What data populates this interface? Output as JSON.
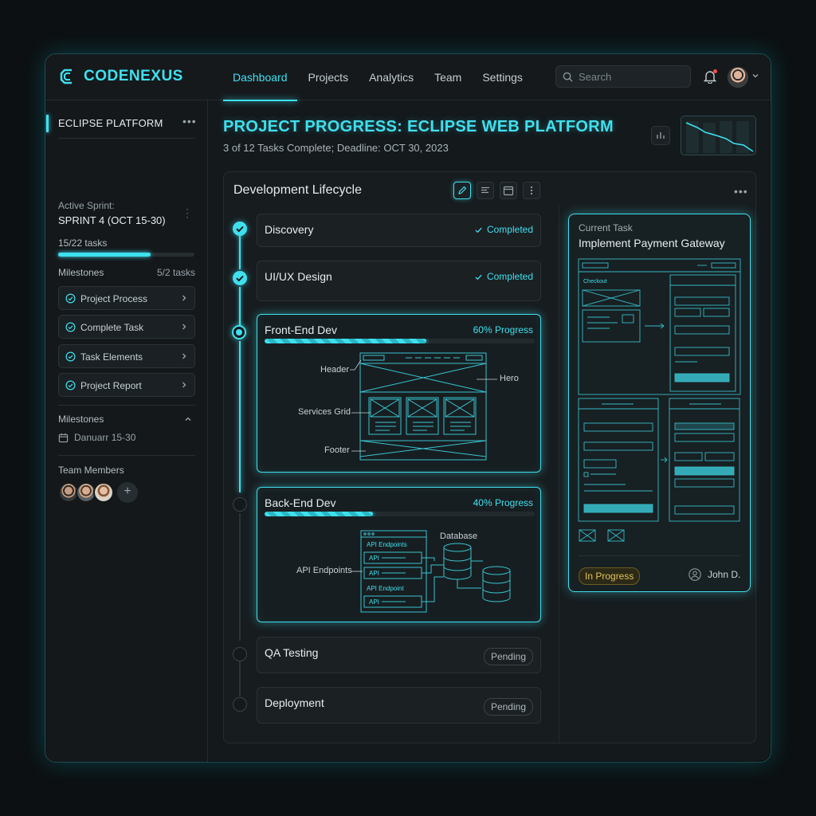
{
  "app": {
    "logo_text": "CODENEXUS"
  },
  "nav": {
    "items": [
      {
        "label": "Dashboard",
        "active": true
      },
      {
        "label": "Projects",
        "active": false
      },
      {
        "label": "Analytics",
        "active": false
      },
      {
        "label": "Team",
        "active": false
      },
      {
        "label": "Settings",
        "active": false
      }
    ]
  },
  "search": {
    "placeholder": "Search"
  },
  "sidebar": {
    "project_name": "ECLIPSE PLATFORM",
    "sprint_label": "Active Sprint:",
    "sprint_value": "SPRINT 4 (OCT 15-30)",
    "tasks_text": "15/22 tasks",
    "tasks_progress": 0.68,
    "milestones_label": "Milestones",
    "milestones_count": "5/2 tasks",
    "milestones": [
      {
        "label": "Project Process"
      },
      {
        "label": "Complete Task"
      },
      {
        "label": "Task Elements"
      },
      {
        "label": "Project Report"
      }
    ],
    "milestones2_label": "Milestones",
    "date_text": "Danuarr 15-30",
    "team_label": "Team Members"
  },
  "main": {
    "title": "PROJECT PROGRESS: ECLIPSE WEB PLATFORM",
    "subtitle": "3 of 12 Tasks Complete; Deadline: OCT 30, 2023"
  },
  "lifecycle": {
    "title": "Development Lifecycle",
    "stages": [
      {
        "title": "Discovery",
        "status": "Completed"
      },
      {
        "title": "UI/UX Design",
        "status": "Completed"
      },
      {
        "title": "Front-End Dev",
        "status": "60% Progress",
        "progress": 0.6,
        "wireframe_labels": {
          "header": "Header",
          "hero": "Hero",
          "grid": "Services Grid",
          "footer": "Footer"
        }
      },
      {
        "title": "Back-End Dev",
        "status": "40% Progress",
        "progress": 0.4,
        "diagram_labels": {
          "api": "API Endpoints",
          "api_box1": "API Endpoints",
          "api_box2": "API Endpoint",
          "api_item": "API",
          "database": "Database"
        }
      },
      {
        "title": "QA Testing",
        "status": "Pending"
      },
      {
        "title": "Deployment",
        "status": "Pending"
      }
    ]
  },
  "current_task": {
    "label": "Current Task",
    "title": "Implement Payment Gateway",
    "status": "In Progress",
    "assignee": "John D.",
    "mockup_labels": {
      "checkout": "Checkout"
    }
  },
  "colors": {
    "accent": "#3fe0ee",
    "background": "#0c1012",
    "pending_badge": "#e0c25a"
  }
}
